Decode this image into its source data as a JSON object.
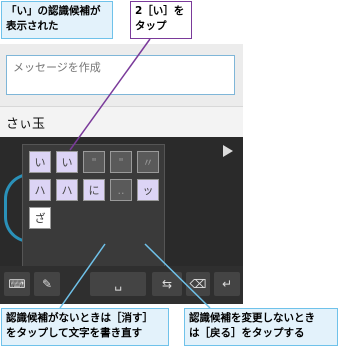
{
  "callouts": {
    "top_left": "「い」の認識候補が\n表示された",
    "step2": "2［い］を\nタップ",
    "bottom_left": "認識候補がないときは［消す］\nをタップして文字を書き直す",
    "bottom_right": "認識候補を変更しないとき\nは［戻る］をタップする"
  },
  "message": {
    "placeholder": "メッセージを作成"
  },
  "compose_text": "さぃ玉",
  "candidates": {
    "row1": [
      "い",
      "い",
      "\"",
      "\"",
      "〃"
    ],
    "row2": [
      "ハ",
      "ハ",
      "に",
      "..",
      "ッ"
    ],
    "row3": [
      "ざ"
    ]
  },
  "popup_buttons": {
    "erase": "消す",
    "back": "戻る"
  },
  "colors": {
    "callout_border": "#6fc2ea",
    "step_border": "#7a3a9a",
    "candidate_bg": "#dcd4f5"
  }
}
